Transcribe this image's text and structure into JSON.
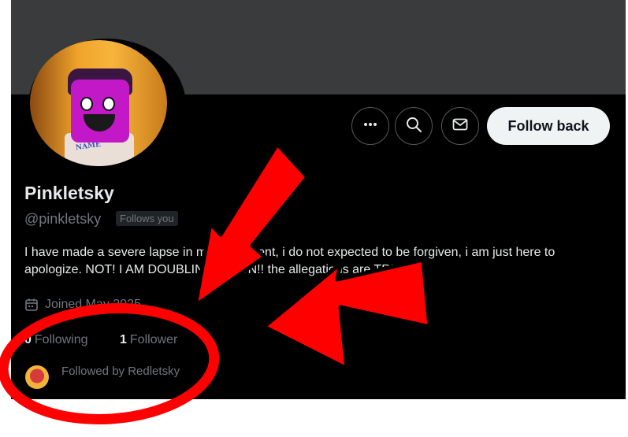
{
  "actions": {
    "more_icon": "more-horizontal-icon",
    "search_icon": "search-icon",
    "message_icon": "envelope-icon",
    "follow_back_label": "Follow back"
  },
  "profile": {
    "display_name": "Pinkletsky",
    "handle": "@pinkletsky",
    "follows_you_badge": "Follows you",
    "bio": "I have made a severe lapse in my judgement, i do not expected to be forgiven, i am just here to apologize. NOT! I AM DOUBLING DOWN!! the allegations are TRUE!!",
    "joined": "Joined May 2025",
    "joined_icon": "calendar-icon",
    "following_count": "0",
    "following_label": "Following",
    "followers_count": "1",
    "followers_label": "Follower",
    "followed_by": "Followed by Redletsky"
  },
  "colors": {
    "page_background": "#000000",
    "banner": "#3a3b3c",
    "primary_text": "#e7e9ea",
    "secondary_text": "#71767b",
    "follow_button_bg": "#eff3f4",
    "annotation_red": "#ff0000"
  }
}
